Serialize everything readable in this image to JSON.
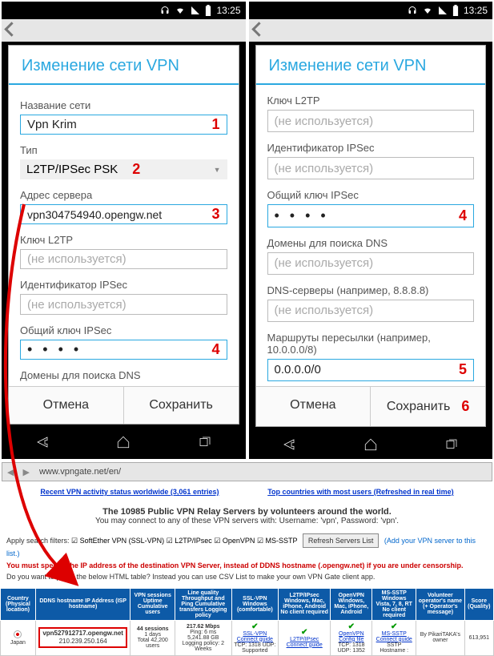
{
  "status": {
    "time": "13:25"
  },
  "dialog": {
    "title": "Изменение сети VPN",
    "name_label": "Название сети",
    "name_value": "Vpn Krim",
    "type_label": "Тип",
    "type_value": "L2TP/IPSec PSK",
    "server_label": "Адрес сервера",
    "server_value": "vpn304754940.opengw.net",
    "l2tp_key_label": "Ключ L2TP",
    "placeholder_unused": "(не используется)",
    "ipsec_id_label": "Идентификатор IPSec",
    "ipsec_key_label": "Общий ключ IPSec",
    "psk_mask": "• • • •",
    "dns_search_label": "Домены для поиска DNS",
    "dns_servers_label": "DNS-серверы (например, 8.8.8.8)",
    "routes_label": "Маршруты пересылки (например, 10.0.0.0/8)",
    "routes_value": "0.0.0.0/0",
    "cancel": "Отмена",
    "save": "Сохранить"
  },
  "marks": {
    "m1": "1",
    "m2": "2",
    "m3": "3",
    "m4": "4",
    "m5": "5",
    "m6": "6"
  },
  "browser": {
    "url": "www.vpngate.net/en/",
    "recent_link": "Recent VPN activity status worldwide (3,061 entries)",
    "top_link": "Top countries with most users (Refreshed in real time)",
    "headline": "The 10985 Public VPN Relay Servers by volunteers around the world.",
    "subline": "You may connect to any of these VPN servers with: Username: 'vpn', Password: 'vpn'.",
    "filters_lead": "Apply search filters:",
    "filter1": "SoftEther VPN (SSL-VPN)",
    "filter2": "L2TP/IPsec",
    "filter3": "OpenVPN",
    "filter4": "MS-SSTP",
    "refresh": "Refresh Servers List",
    "add_server": "(Add your VPN server to this list.)",
    "warn": "You must specify the IP address of the destination VPN Server, instead of DDNS hostname (.opengw.net) if you are under censorship.",
    "csv": "Do you want to parse the below HTML table? Instead you can use CSV List to make your own VPN Gate client app.",
    "csv_link": "CSV List"
  },
  "table": {
    "h_country": "Country (Physical location)",
    "h_host": "DDNS hostname IP Address (ISP hostname)",
    "h_sessions": "VPN sessions Uptime Cumulative users",
    "h_line": "Line quality Throughput and Ping Cumulative transfers Logging policy",
    "h_ssl": "SSL-VPN Windows (comfortable)",
    "h_l2tp": "L2TP/IPsec Windows, Mac, iPhone, Android No client required",
    "h_ovpn": "OpenVPN Windows, Mac, iPhone, Android",
    "h_sstp": "MS-SSTP Windows Vista, 7, 8, RT No client required",
    "h_op": "Volunteer operator's name (+ Operator's message)",
    "h_score": "Score (Quality)",
    "row": {
      "country": "Japan",
      "host_line1": "vpn527912717.opengw.net",
      "host_line2": "210.239.250.164",
      "sessions": "44 sessions",
      "uptime": "1 days",
      "cumulative": "Total 42,200 users",
      "speed": "217.62 Mbps",
      "ping": "Ping: 6 ms",
      "transfer": "5,241.88 GB",
      "log": "Logging policy: 2 Weeks",
      "ssl": "SSL-VPN Connect guide",
      "ssl_port": "TCP: 1318 UDP: Supported",
      "l2tp": "L2TP/IPsec Connect guide",
      "ovpn": "OpenVPN Config file",
      "ovpn_port": "TCP: 1318 UDP: 1352",
      "sstp": "MS-SSTP Connect guide",
      "sstp_host": "SSTP Hostname :",
      "op": "By PikariTAKA's owner",
      "score": "613,951"
    }
  }
}
